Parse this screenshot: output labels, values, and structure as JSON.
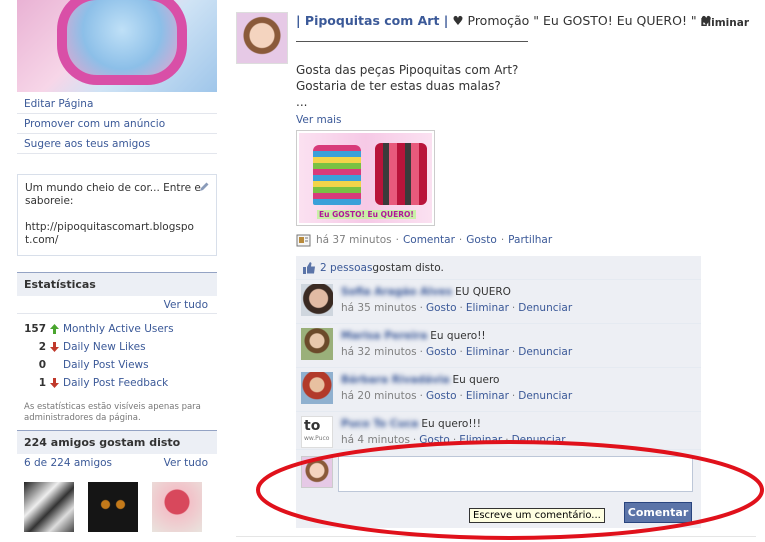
{
  "sidebar": {
    "links": [
      {
        "label": "Editar Página"
      },
      {
        "label": "Promover com um anúncio"
      },
      {
        "label": "Sugere aos teus amigos"
      }
    ],
    "about": {
      "text": "Um mundo cheio de cor... Entre e saboreie:",
      "url": "http://pipoquitascomart.blogspot.com/"
    },
    "stats": {
      "heading": "Estatísticas",
      "see_all": "Ver tudo",
      "rows": [
        {
          "value": "157",
          "trend": "up",
          "label": "Monthly Active Users"
        },
        {
          "value": "2",
          "trend": "down",
          "label": "Daily New Likes"
        },
        {
          "value": "0",
          "trend": "none",
          "label": "Daily Post Views"
        },
        {
          "value": "1",
          "trend": "down",
          "label": "Daily Post Feedback"
        }
      ],
      "note": "As estatísticas estão visíveis apenas para administradores da página."
    },
    "friends": {
      "heading": "224 amigos gostam disto",
      "count_link": "6 de 224 amigos",
      "see_all": "Ver tudo"
    }
  },
  "post": {
    "page_name": "| Pipoquitas com Art |",
    "headline": " ♥ Promoção \" Eu GOSTO! Eu QUERO! \" ♥",
    "delete_label": "Eliminar",
    "body_line1": "Gosta das peças Pipoquitas com Art?",
    "body_line2": "Gostaria de ter estas duas malas?",
    "body_line3": "...",
    "see_more": "Ver mais",
    "image_caption": "Eu GOSTO! Eu QUERO!",
    "time": "há 37 minutos",
    "actions": {
      "comment": "Comentar",
      "like": "Gosto",
      "share": "Partilhar"
    },
    "likes": {
      "count_link": "2 pessoas",
      "suffix": " gostam disto."
    }
  },
  "comments": [
    {
      "author": "Sofia Aragão Alves",
      "text": "EU QUERO",
      "time": "há 35 minutos",
      "like": "Gosto",
      "delete": "Eliminar",
      "report": "Denunciar"
    },
    {
      "author": "Marisa Pereira",
      "text": "Eu quero!!",
      "time": "há 32 minutos",
      "like": "Gosto",
      "delete": "Eliminar",
      "report": "Denunciar"
    },
    {
      "author": "Bárbara Rivadávia",
      "text": "Eu quero",
      "time": "há 20 minutos",
      "like": "Gosto",
      "delete": "Eliminar",
      "report": "Denunciar"
    },
    {
      "author": "Puco To Cuca",
      "text": "Eu quero!!!",
      "time": "há 4 minutos",
      "like": "Gosto",
      "delete": "Eliminar",
      "report": "Denunciar",
      "avatar_text": "to",
      "avatar_small": "ww.Puco"
    }
  ],
  "composer": {
    "value": "",
    "tooltip": "Escreve um comentário...",
    "submit_label": "Comentar"
  },
  "colors": {
    "link": "#3b5998",
    "highlight": "#e0111b",
    "trend_up": "#4aa52e",
    "trend_down": "#c0392b"
  }
}
